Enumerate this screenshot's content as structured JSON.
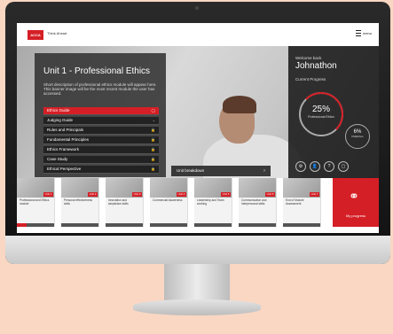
{
  "header": {
    "brand": "ACCA",
    "tagline": "Think Ahead",
    "menu_label": "menu"
  },
  "unit": {
    "title": "Unit 1 - Professional Ethics",
    "description": "Short description of professional ethics module will appear here. This banner image will be the most recent module the user has accessed."
  },
  "modules": [
    {
      "label": "Ethics Guide",
      "active": true,
      "icon": "circle-icon"
    },
    {
      "label": "Judging Guide",
      "active": false,
      "icon": "arrow-icon"
    },
    {
      "label": "Rules and Principals",
      "active": false,
      "icon": "lock-icon"
    },
    {
      "label": "Fundamental Principles",
      "active": false,
      "icon": "lock-icon"
    },
    {
      "label": "Ethics Framework",
      "active": false,
      "icon": "lock-icon"
    },
    {
      "label": "Case Study",
      "active": false,
      "icon": "lock-icon"
    },
    {
      "label": "Ethical Perspective",
      "active": false,
      "icon": "lock-icon"
    }
  ],
  "unit_breakdown": {
    "label": "Unit breakdown",
    "icon": "?"
  },
  "profile": {
    "welcome": "Welcome back",
    "name": "Johnathon",
    "current_progress": "Current Progress",
    "ring1": {
      "pct": "25%",
      "label": "Professional Ethics"
    },
    "ring2": {
      "pct": "6%",
      "label": "OVERALL"
    },
    "icon_buttons": [
      "⚙",
      "👤",
      "?",
      "▢"
    ]
  },
  "tiles": [
    {
      "unit": "Unit 1",
      "label": "Professional and Ethics module",
      "progress": 0.25
    },
    {
      "unit": "Unit 2",
      "label": "Personal effectiveness skills",
      "progress": 0
    },
    {
      "unit": "Unit 3",
      "label": "Innovation and skepticism skills",
      "progress": 0
    },
    {
      "unit": "Unit 4",
      "label": "Commercial Awareness",
      "progress": 0
    },
    {
      "unit": "Unit 5",
      "label": "Leadership and Team working",
      "progress": 0
    },
    {
      "unit": "Unit 6",
      "label": "Communication and Interpersonal skills",
      "progress": 0
    },
    {
      "unit": "Unit 7",
      "label": "End of Module Assessment",
      "progress": 0
    }
  ],
  "progress_tile": {
    "label": "My progress"
  },
  "colors": {
    "accent": "#d51f26",
    "dark_panel": "#323232"
  }
}
